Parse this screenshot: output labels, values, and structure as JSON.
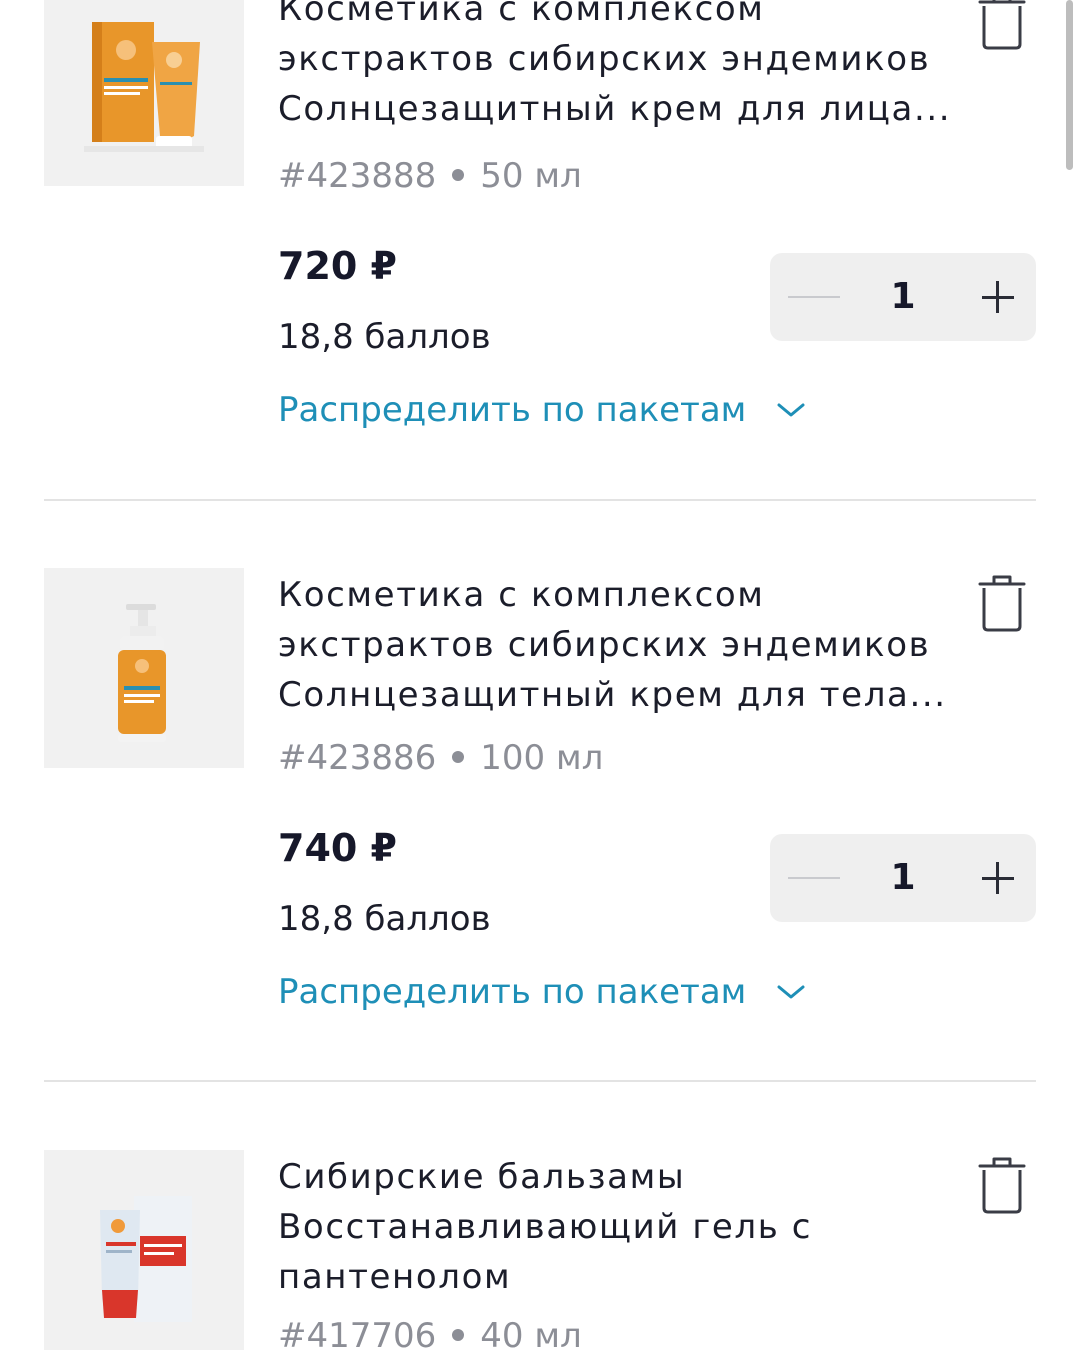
{
  "products": [
    {
      "title_lines": [
        "Косметика с комплексом",
        "экстрактов сибирских эндемиков",
        "Солнцезащитный крем для лица..."
      ],
      "sku": "#423888",
      "volume": "50 мл",
      "price": "720 ₽",
      "points": "18,8 баллов",
      "quantity": "1",
      "distribute_label": "Распределить по пакетам",
      "package_color": "#e8962a"
    },
    {
      "title_lines": [
        "Косметика с комплексом",
        "экстрактов сибирских эндемиков",
        "Солнцезащитный крем для тела..."
      ],
      "sku": "#423886",
      "volume": "100 мл",
      "price": "740 ₽",
      "points": "18,8 баллов",
      "quantity": "1",
      "distribute_label": "Распределить по пакетам",
      "package_color": "#e8962a"
    },
    {
      "title_lines": [
        "Сибирские бальзамы",
        "Восстанавливающий гель с",
        "пантенолом"
      ],
      "sku": "#417706",
      "volume": "40 мл",
      "package_color": "#d9362b"
    }
  ],
  "colors": {
    "link": "#1e8fb7",
    "text": "#1b1d2a",
    "muted": "#8c8e96",
    "stepper_bg": "#efefef"
  }
}
